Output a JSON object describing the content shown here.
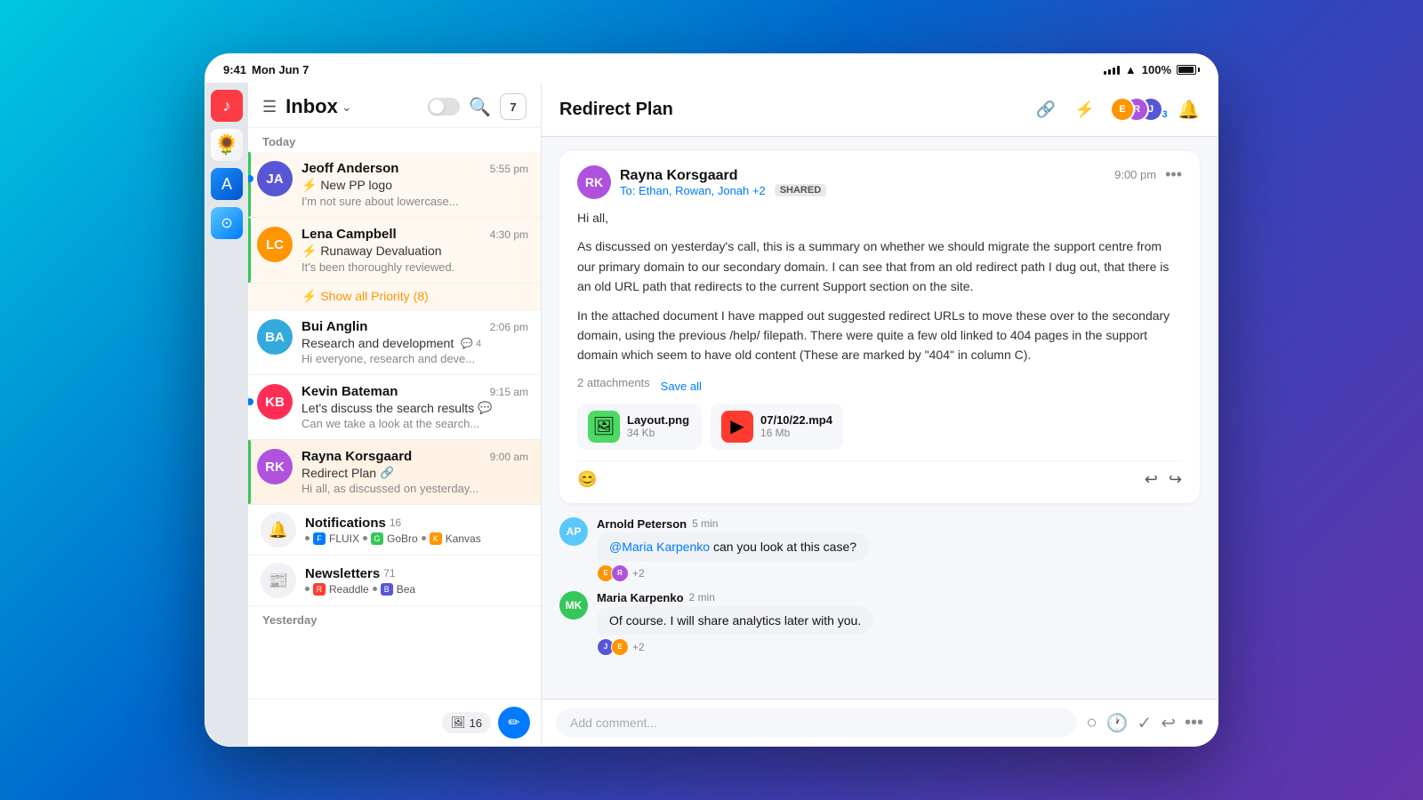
{
  "statusBar": {
    "time": "9:41",
    "date": "Mon Jun 7",
    "battery": "100%"
  },
  "inbox": {
    "title": "Inbox",
    "badgeCount": "7",
    "sectionToday": "Today",
    "sectionYesterday": "Yesterday",
    "showAllPriority": "⚡ Show all Priority (8)",
    "items": [
      {
        "sender": "Jeoff Anderson",
        "initials": "JA",
        "color": "#5856d6",
        "subject": "⚡ New PP logo",
        "preview": "I'm not sure about lowercase...",
        "time": "5:55 pm",
        "unread": true,
        "priority": true
      },
      {
        "sender": "Lena Campbell",
        "initials": "LC",
        "color": "#ff9500",
        "subject": "⚡ Runaway Devaluation",
        "preview": "It's been thoroughly reviewed.",
        "time": "4:30 pm",
        "unread": false,
        "priority": true
      },
      {
        "sender": "Bui Anglin",
        "initials": "BA",
        "color": "#34aadc",
        "subject": "Research and development",
        "preview": "Hi everyone, research and deve...",
        "time": "2:06 pm",
        "unread": false,
        "priority": false,
        "threadCount": 4
      },
      {
        "sender": "Kevin Bateman",
        "initials": "KB",
        "color": "#ff2d55",
        "subject": "Let's discuss the search results",
        "preview": "Can we take a look at the search...",
        "time": "9:15 am",
        "unread": true,
        "priority": false,
        "hasThread": true
      },
      {
        "sender": "Rayna Korsgaard",
        "initials": "RK",
        "color": "#af52de",
        "subject": "Redirect Plan",
        "preview": "Hi all, as discussed on yesterday...",
        "time": "9:00 am",
        "unread": false,
        "priority": true,
        "selected": true,
        "hasThread": true
      }
    ],
    "notifications": {
      "title": "Notifications",
      "count": "16",
      "sources": [
        "FLUIX",
        "GoBro",
        "Kanvas"
      ]
    },
    "newsletters": {
      "title": "Newsletters",
      "count": "71",
      "sources": [
        "Readdle",
        "Bea"
      ]
    }
  },
  "emailDetail": {
    "title": "Redirect Plan",
    "message": {
      "sender": "Rayna Korsgaard",
      "initials": "RK",
      "color": "#af52de",
      "toLine": "To: Ethan, Rowan, Jonah +2",
      "sharedLabel": "SHARED",
      "time": "9:00 pm",
      "body1": "Hi all,",
      "body2": "As discussed on yesterday's call, this is a summary on whether we should migrate the support centre from our primary domain to our secondary domain. I can see that from an old redirect path I dug out, that there is an old URL path that redirects to the current Support section on the site.",
      "body3": "In the attached document I have mapped out suggested redirect URLs to move these over to the secondary domain, using the previous /help/ filepath. There were quite a few old linked to 404 pages in the support domain which seem to have old content (These are marked by \"404\" in column C).",
      "attachmentsLabel": "2 attachments",
      "saveAll": "Save all",
      "attachments": [
        {
          "name": "Layout.png",
          "size": "34 Kb",
          "type": "image"
        },
        {
          "name": "07/10/22.mp4",
          "size": "16 Mb",
          "type": "video"
        }
      ]
    },
    "comments": [
      {
        "sender": "Arnold Peterson",
        "initials": "AP",
        "color": "#5ac8fa",
        "time": "5 min",
        "bubble": "@Maria Karpenko can you look at this case?",
        "mention": "@Maria Karpenko",
        "reactions": [
          "+2"
        ]
      },
      {
        "sender": "Maria Karpenko",
        "initials": "MK",
        "color": "#34c759",
        "time": "2 min",
        "bubble": "Of course. I will share analytics later with you.",
        "reactions": [
          "+2"
        ]
      }
    ],
    "commentPlaceholder": "Add comment...",
    "avatarGroup": {
      "members": [
        "E",
        "R",
        "J"
      ],
      "colors": [
        "#ff9500",
        "#af52de",
        "#5856d6"
      ],
      "extra": "+3"
    }
  },
  "actions": {
    "reactionBtn": "↩",
    "replyBtn": "↩",
    "forwardBtn": "↪",
    "chipLabel": "16",
    "composePen": "✏"
  }
}
